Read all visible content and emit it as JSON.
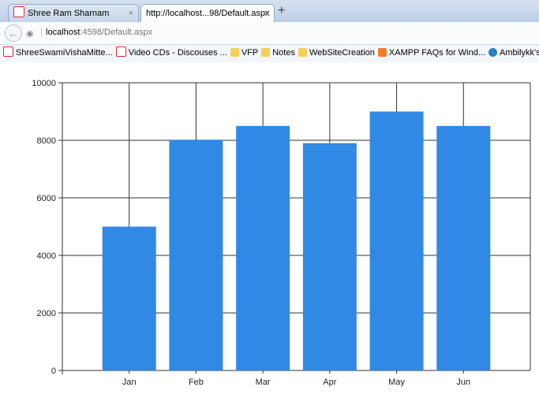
{
  "browser": {
    "tabs": [
      {
        "title": "Shree Ram Sharnam",
        "active": false
      },
      {
        "title": "http://localhost...98/Default.aspx",
        "active": true
      }
    ],
    "close_glyph": "×",
    "new_tab_glyph": "+",
    "back_glyph": "←",
    "globe_glyph": "◉",
    "url_host": "localhost",
    "url_rest": ":4598/Default.aspx",
    "bookmarks": [
      {
        "label": "ShreeSwamiVishaMitte...",
        "icon": "page-icon"
      },
      {
        "label": "Video CDs - Discouses ...",
        "icon": "page-icon"
      },
      {
        "label": "VFP",
        "icon": "folder-icon"
      },
      {
        "label": "Notes",
        "icon": "folder-icon"
      },
      {
        "label": "WebSiteCreation",
        "icon": "folder-icon"
      },
      {
        "label": "XAMPP FAQs for Wind...",
        "icon": "xampp-icon"
      },
      {
        "label": "Ambilykk's Blog | My I...",
        "icon": "wordpress-icon"
      }
    ]
  },
  "chart_data": {
    "type": "bar",
    "categories": [
      "Jan",
      "Feb",
      "Mar",
      "Apr",
      "May",
      "Jun"
    ],
    "values": [
      5000,
      8000,
      8500,
      7900,
      9000,
      8500
    ],
    "yticks": [
      0,
      2000,
      4000,
      6000,
      8000,
      10000
    ],
    "ylim": [
      0,
      10000
    ],
    "grid": true,
    "bar_color": "#3189e6",
    "title": "",
    "xlabel": "",
    "ylabel": ""
  }
}
